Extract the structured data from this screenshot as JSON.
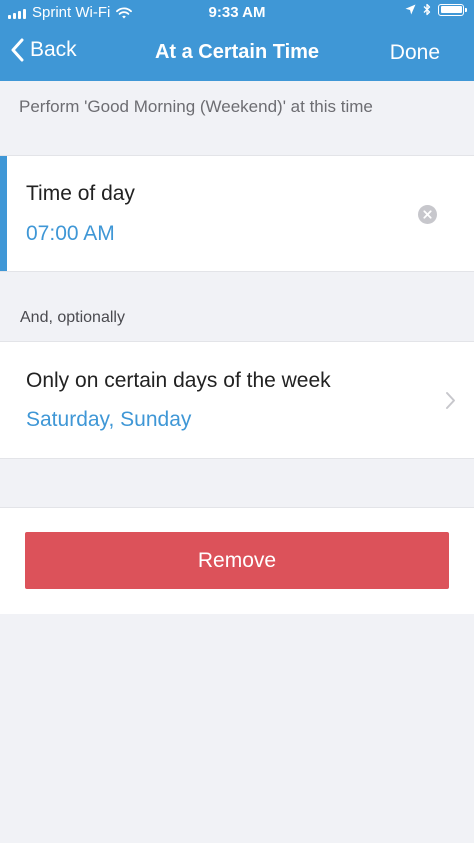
{
  "status_bar": {
    "carrier": "Sprint Wi-Fi",
    "time": "9:33 AM"
  },
  "nav": {
    "back_label": "Back",
    "title": "At a Certain Time",
    "done_label": "Done"
  },
  "description": "Perform 'Good Morning (Weekend)' at this time",
  "time_of_day": {
    "label": "Time of day",
    "value": "07:00 AM"
  },
  "optional_section": {
    "label": "And, optionally"
  },
  "days_of_week": {
    "label": "Only on certain days of the week",
    "value": "Saturday, Sunday"
  },
  "remove_label": "Remove",
  "colors": {
    "accent": "#3f97d6",
    "destructive": "#dc525a",
    "background": "#f1f2f6"
  },
  "icons": [
    "signal-bars-icon",
    "wifi-icon",
    "location-arrow-icon",
    "bluetooth-icon",
    "battery-icon",
    "chevron-left-icon",
    "clear-icon",
    "chevron-right-icon"
  ]
}
